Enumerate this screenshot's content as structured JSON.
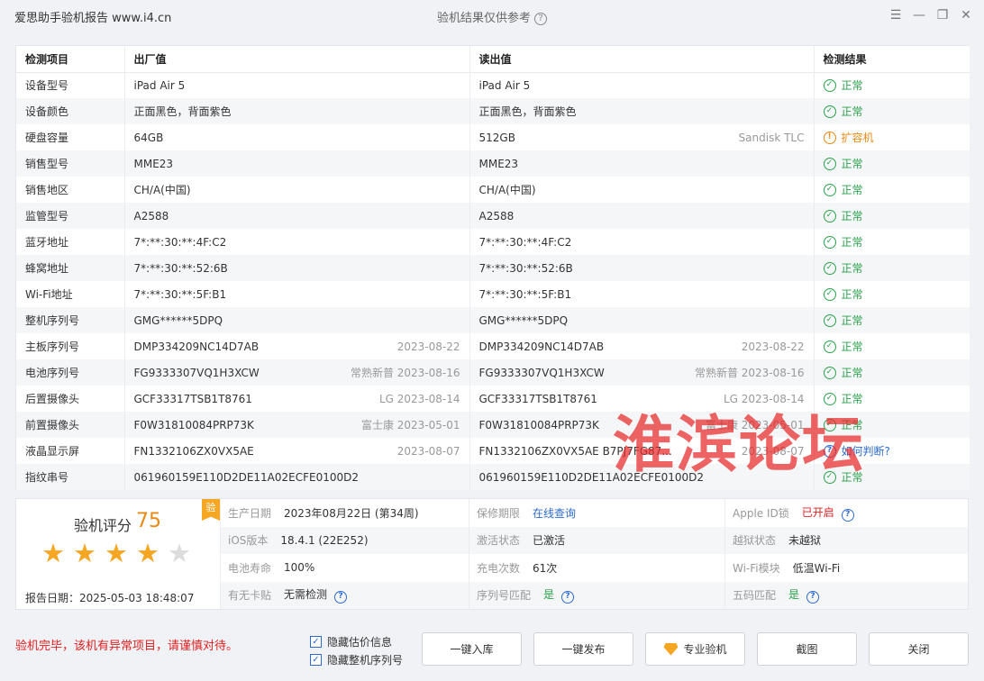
{
  "window": {
    "app_title": "爱思助手验机报告 www.i4.cn",
    "center_title": "验机结果仅供参考",
    "help_glyph": "?"
  },
  "table": {
    "headers": [
      "检测项目",
      "出厂值",
      "读出值",
      "检测结果"
    ],
    "rows": [
      {
        "item": "设备型号",
        "factory": "iPad Air 5",
        "factory_note": "",
        "read": "iPad Air 5",
        "read_note": "",
        "result": "正常",
        "status": "ok"
      },
      {
        "item": "设备颜色",
        "factory": "正面黑色，背面紫色",
        "factory_note": "",
        "read": "正面黑色，背面紫色",
        "read_note": "",
        "result": "正常",
        "status": "ok"
      },
      {
        "item": "硬盘容量",
        "factory": "64GB",
        "factory_note": "",
        "read": "512GB",
        "read_note": "Sandisk TLC",
        "result": "扩容机",
        "status": "warn"
      },
      {
        "item": "销售型号",
        "factory": "MME23",
        "factory_note": "",
        "read": "MME23",
        "read_note": "",
        "result": "正常",
        "status": "ok"
      },
      {
        "item": "销售地区",
        "factory": "CH/A(中国)",
        "factory_note": "",
        "read": "CH/A(中国)",
        "read_note": "",
        "result": "正常",
        "status": "ok"
      },
      {
        "item": "监管型号",
        "factory": "A2588",
        "factory_note": "",
        "read": "A2588",
        "read_note": "",
        "result": "正常",
        "status": "ok"
      },
      {
        "item": "蓝牙地址",
        "factory": "7*:**:30:**:4F:C2",
        "factory_note": "",
        "read": "7*:**:30:**:4F:C2",
        "read_note": "",
        "result": "正常",
        "status": "ok"
      },
      {
        "item": "蜂窝地址",
        "factory": "7*:**:30:**:52:6B",
        "factory_note": "",
        "read": "7*:**:30:**:52:6B",
        "read_note": "",
        "result": "正常",
        "status": "ok"
      },
      {
        "item": "Wi-Fi地址",
        "factory": "7*:**:30:**:5F:B1",
        "factory_note": "",
        "read": "7*:**:30:**:5F:B1",
        "read_note": "",
        "result": "正常",
        "status": "ok"
      },
      {
        "item": "整机序列号",
        "factory": "GMG******5DPQ",
        "factory_note": "",
        "read": "GMG******5DPQ",
        "read_note": "",
        "result": "正常",
        "status": "ok"
      },
      {
        "item": "主板序列号",
        "factory": "DMP334209NC14D7AB",
        "factory_note": "2023-08-22",
        "read": "DMP334209NC14D7AB",
        "read_note": "2023-08-22",
        "result": "正常",
        "status": "ok"
      },
      {
        "item": "电池序列号",
        "factory": "FG9333307VQ1H3XCW",
        "factory_note": "常熟新普 2023-08-16",
        "read": "FG9333307VQ1H3XCW",
        "read_note": "常熟新普 2023-08-16",
        "result": "正常",
        "status": "ok"
      },
      {
        "item": "后置摄像头",
        "factory": "GCF33317TSB1T8761",
        "factory_note": "LG 2023-08-14",
        "read": "GCF33317TSB1T8761",
        "read_note": "LG 2023-08-14",
        "result": "正常",
        "status": "ok"
      },
      {
        "item": "前置摄像头",
        "factory": "F0W31810084PRP73K",
        "factory_note": "富士康 2023-05-01",
        "read": "F0W31810084PRP73K",
        "read_note": "富士康 2023-05-01",
        "result": "正常",
        "status": "ok"
      },
      {
        "item": "液晶显示屏",
        "factory": "FN1332106ZX0VX5AE",
        "factory_note": "2023-08-07",
        "read": "FN1332106ZX0VX5AE B7PJ7FG87...",
        "read_note": "2023-08-07",
        "result": "如何判断?",
        "status": "question"
      },
      {
        "item": "指纹串号",
        "factory": "061960159E110D2DE11A02ECFE0100D2",
        "factory_note": "",
        "read": "061960159E110D2DE11A02ECFE0100D2",
        "read_note": "",
        "result": "正常",
        "status": "ok"
      }
    ]
  },
  "watermark": "淮滨论坛",
  "score": {
    "label": "验机评分",
    "value": "75",
    "badge": "验",
    "stars_filled": 4,
    "stars_total": 5,
    "report_date": "报告日期：2025-05-03 18:48:07"
  },
  "summary": [
    {
      "label": "生产日期",
      "value": "2023年08月22日 (第34周)",
      "style": "normal",
      "help": false
    },
    {
      "label": "保修期限",
      "value": "在线查询",
      "style": "link",
      "help": false
    },
    {
      "label": "Apple ID锁",
      "value": "已开启",
      "style": "red",
      "help": true
    },
    {
      "label": "iOS版本",
      "value": "18.4.1 (22E252)",
      "style": "normal",
      "help": false
    },
    {
      "label": "激活状态",
      "value": "已激活",
      "style": "normal",
      "help": false
    },
    {
      "label": "越狱状态",
      "value": "未越狱",
      "style": "normal",
      "help": false
    },
    {
      "label": "电池寿命",
      "value": "100%",
      "style": "normal",
      "help": false
    },
    {
      "label": "充电次数",
      "value": "61次",
      "style": "normal",
      "help": false
    },
    {
      "label": "Wi-Fi模块",
      "value": "低温Wi-Fi",
      "style": "normal",
      "help": false
    },
    {
      "label": "有无卡贴",
      "value": "无需检测",
      "style": "normal",
      "help": true
    },
    {
      "label": "序列号匹配",
      "value": "是",
      "style": "green",
      "help": true
    },
    {
      "label": "五码匹配",
      "value": "是",
      "style": "green",
      "help": true
    }
  ],
  "footer": {
    "message": "验机完毕，该机有异常项目，请谨慎对待。",
    "checkbox_1": "隐藏估价信息",
    "checkbox_2": "隐藏整机序列号",
    "buttons": {
      "import": "一键入库",
      "publish": "一键发布",
      "pro": "专业验机",
      "screenshot": "截图",
      "close": "关闭"
    }
  },
  "colors": {
    "ok": "#2aa14a",
    "warn": "#e78a14",
    "link": "#2d6bd0",
    "alert": "#e02020",
    "star": "#f5a623"
  }
}
